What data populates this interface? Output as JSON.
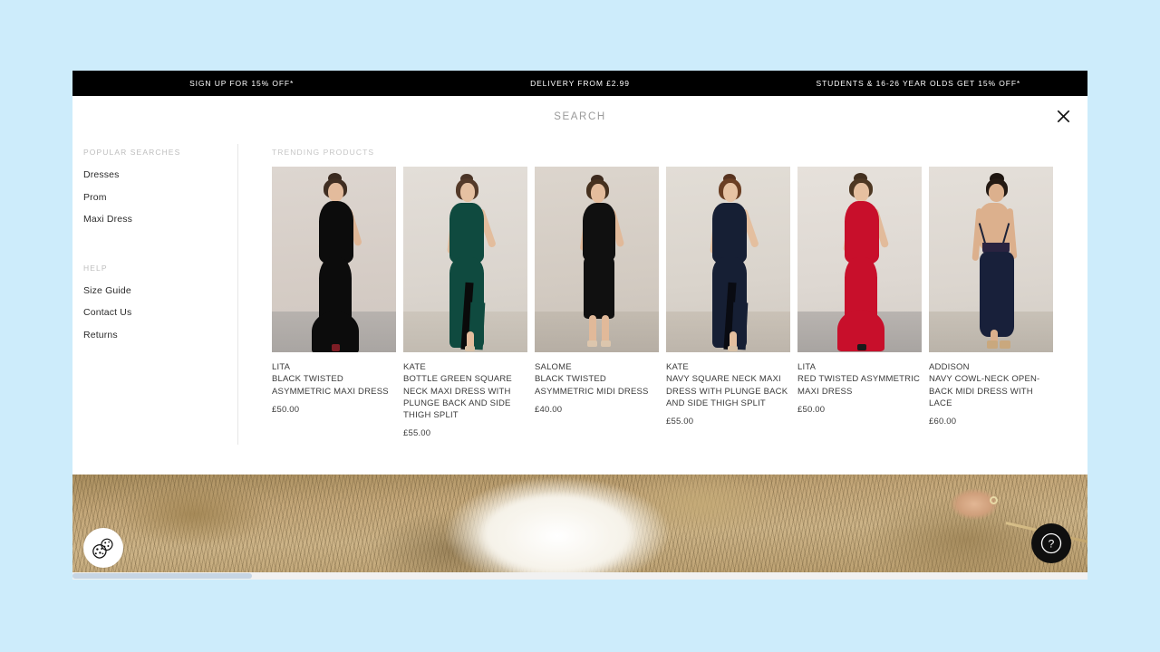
{
  "promo": {
    "items": [
      "SIGN UP FOR 15% OFF*",
      "DELIVERY FROM £2.99",
      "STUDENTS & 16-26 YEAR OLDS GET 15% OFF*"
    ]
  },
  "search": {
    "placeholder": "SEARCH",
    "value": "",
    "close_icon": "close-icon"
  },
  "sidebar": {
    "popular_heading": "POPULAR SEARCHES",
    "popular_items": [
      "Dresses",
      "Prom",
      "Maxi Dress"
    ],
    "help_heading": "HELP",
    "help_items": [
      "Size Guide",
      "Contact Us",
      "Returns"
    ]
  },
  "trending": {
    "heading": "TRENDING PRODUCTS",
    "products": [
      {
        "brand": "LITA",
        "title": "BLACK TWISTED ASYMMETRIC MAXI DRESS",
        "price": "£50.00",
        "dress_color": "#0c0c0c",
        "backdrop": "#d7cfc9"
      },
      {
        "brand": "KATE",
        "title": "BOTTLE GREEN SQUARE NECK MAXI DRESS WITH PLUNGE BACK AND SIDE THIGH SPLIT",
        "price": "£55.00",
        "dress_color": "#0f4a3f",
        "backdrop": "#ddd8d2"
      },
      {
        "brand": "SALOME",
        "title": "BLACK TWISTED ASYMMETRIC MIDI DRESS",
        "price": "£40.00",
        "dress_color": "#101010",
        "backdrop": "#d6d0c8"
      },
      {
        "brand": "KATE",
        "title": "NAVY SQUARE NECK MAXI DRESS WITH PLUNGE BACK AND SIDE THIGH SPLIT",
        "price": "£55.00",
        "dress_color": "#161f34",
        "backdrop": "#dcd6cf"
      },
      {
        "brand": "LITA",
        "title": "RED TWISTED ASYMMETRIC MAXI DRESS",
        "price": "£50.00",
        "dress_color": "#c80f2b",
        "backdrop": "#e0dbd6"
      },
      {
        "brand": "ADDISON",
        "title": "NAVY COWL-NECK OPEN-BACK MIDI DRESS WITH LACE",
        "price": "£60.00",
        "dress_color": "#18203a",
        "backdrop": "#dedad4"
      }
    ]
  },
  "floating": {
    "cookie_icon": "cookie-icon",
    "help_icon": "question-mark-icon"
  },
  "theme": {
    "page_background": "#cdecfb",
    "promo_background": "#000000",
    "panel_background": "#ffffff",
    "text_primary": "#3a3a3a",
    "text_muted": "#bdbdbd",
    "scrollbar_thumb": "#c6d5e4"
  }
}
